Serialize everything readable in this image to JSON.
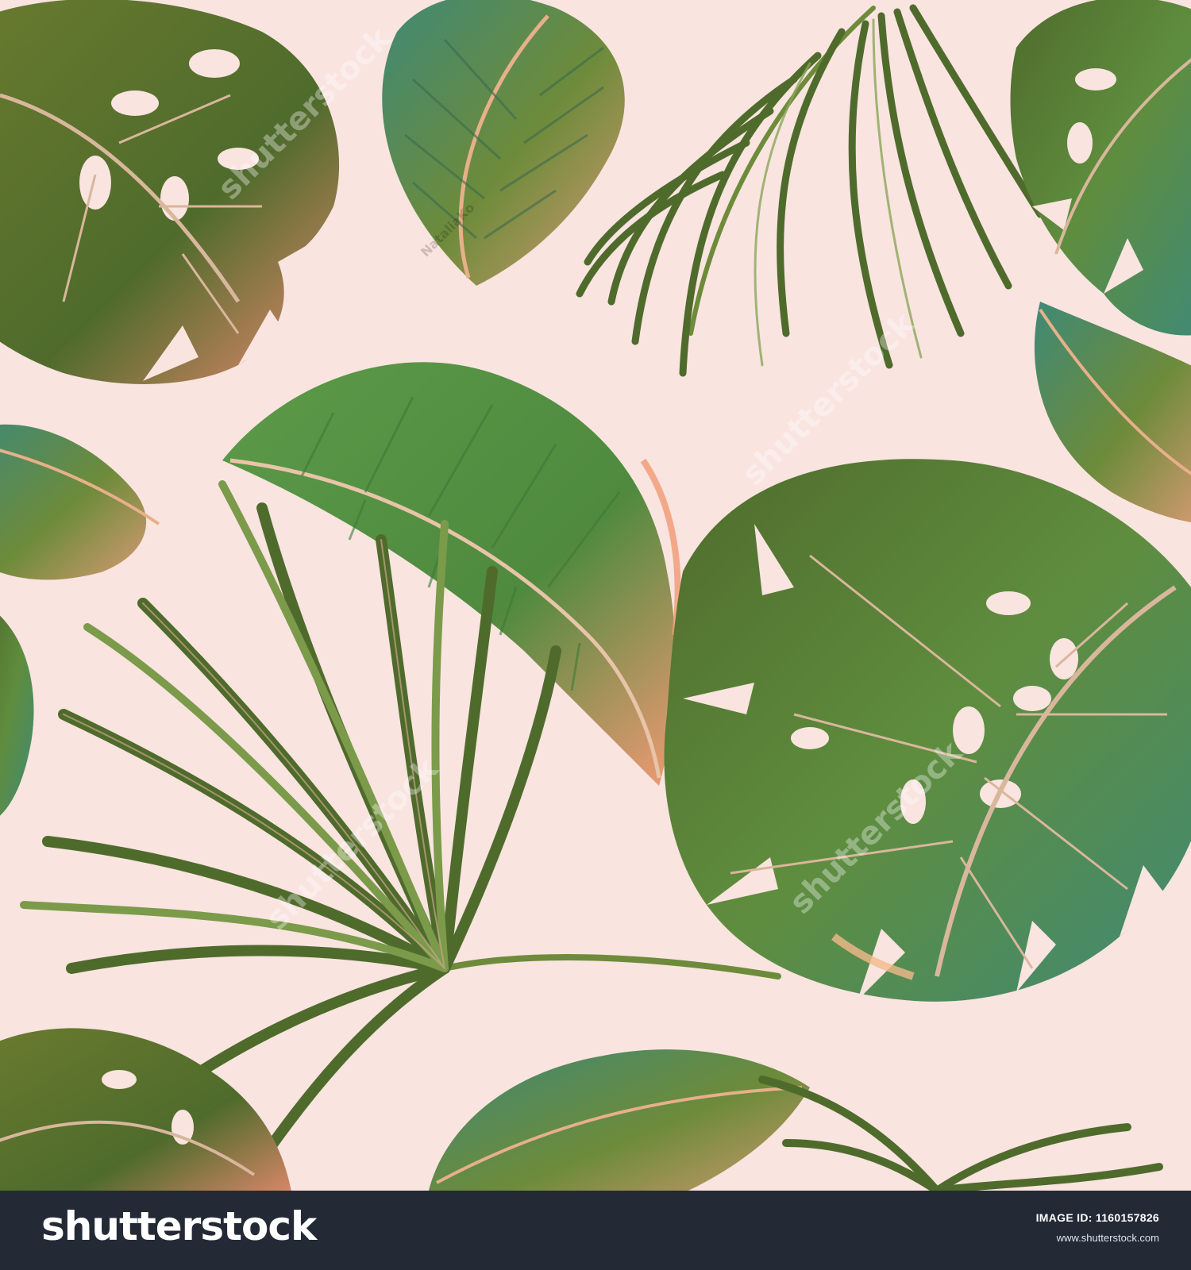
{
  "image": {
    "background_color": "#f9e4e0",
    "leaf_colors": {
      "dark_green": "#4f6b2c",
      "mid_green": "#6d8b3a",
      "teal": "#3f8a76",
      "bright_green": "#5c9a49",
      "coral": "#f09a74",
      "salmon": "#e98a6f"
    },
    "watermark_text": "shutterstock",
    "contributor_text": "NataliaKo"
  },
  "footer": {
    "logo": "shutterstock",
    "image_id_label": "IMAGE ID: 1160157826",
    "url": "www.shutterstock.com",
    "background_color": "#232a36"
  }
}
